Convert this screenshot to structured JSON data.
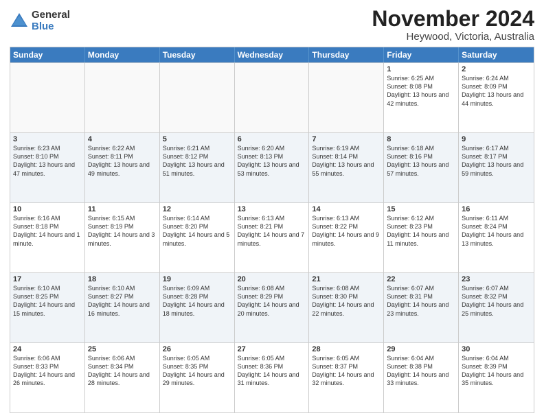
{
  "logo": {
    "general": "General",
    "blue": "Blue"
  },
  "title": "November 2024",
  "subtitle": "Heywood, Victoria, Australia",
  "days_of_week": [
    "Sunday",
    "Monday",
    "Tuesday",
    "Wednesday",
    "Thursday",
    "Friday",
    "Saturday"
  ],
  "weeks": [
    [
      {
        "day": "",
        "info": ""
      },
      {
        "day": "",
        "info": ""
      },
      {
        "day": "",
        "info": ""
      },
      {
        "day": "",
        "info": ""
      },
      {
        "day": "",
        "info": ""
      },
      {
        "day": "1",
        "info": "Sunrise: 6:25 AM\nSunset: 8:08 PM\nDaylight: 13 hours and 42 minutes."
      },
      {
        "day": "2",
        "info": "Sunrise: 6:24 AM\nSunset: 8:09 PM\nDaylight: 13 hours and 44 minutes."
      }
    ],
    [
      {
        "day": "3",
        "info": "Sunrise: 6:23 AM\nSunset: 8:10 PM\nDaylight: 13 hours and 47 minutes."
      },
      {
        "day": "4",
        "info": "Sunrise: 6:22 AM\nSunset: 8:11 PM\nDaylight: 13 hours and 49 minutes."
      },
      {
        "day": "5",
        "info": "Sunrise: 6:21 AM\nSunset: 8:12 PM\nDaylight: 13 hours and 51 minutes."
      },
      {
        "day": "6",
        "info": "Sunrise: 6:20 AM\nSunset: 8:13 PM\nDaylight: 13 hours and 53 minutes."
      },
      {
        "day": "7",
        "info": "Sunrise: 6:19 AM\nSunset: 8:14 PM\nDaylight: 13 hours and 55 minutes."
      },
      {
        "day": "8",
        "info": "Sunrise: 6:18 AM\nSunset: 8:16 PM\nDaylight: 13 hours and 57 minutes."
      },
      {
        "day": "9",
        "info": "Sunrise: 6:17 AM\nSunset: 8:17 PM\nDaylight: 13 hours and 59 minutes."
      }
    ],
    [
      {
        "day": "10",
        "info": "Sunrise: 6:16 AM\nSunset: 8:18 PM\nDaylight: 14 hours and 1 minute."
      },
      {
        "day": "11",
        "info": "Sunrise: 6:15 AM\nSunset: 8:19 PM\nDaylight: 14 hours and 3 minutes."
      },
      {
        "day": "12",
        "info": "Sunrise: 6:14 AM\nSunset: 8:20 PM\nDaylight: 14 hours and 5 minutes."
      },
      {
        "day": "13",
        "info": "Sunrise: 6:13 AM\nSunset: 8:21 PM\nDaylight: 14 hours and 7 minutes."
      },
      {
        "day": "14",
        "info": "Sunrise: 6:13 AM\nSunset: 8:22 PM\nDaylight: 14 hours and 9 minutes."
      },
      {
        "day": "15",
        "info": "Sunrise: 6:12 AM\nSunset: 8:23 PM\nDaylight: 14 hours and 11 minutes."
      },
      {
        "day": "16",
        "info": "Sunrise: 6:11 AM\nSunset: 8:24 PM\nDaylight: 14 hours and 13 minutes."
      }
    ],
    [
      {
        "day": "17",
        "info": "Sunrise: 6:10 AM\nSunset: 8:25 PM\nDaylight: 14 hours and 15 minutes."
      },
      {
        "day": "18",
        "info": "Sunrise: 6:10 AM\nSunset: 8:27 PM\nDaylight: 14 hours and 16 minutes."
      },
      {
        "day": "19",
        "info": "Sunrise: 6:09 AM\nSunset: 8:28 PM\nDaylight: 14 hours and 18 minutes."
      },
      {
        "day": "20",
        "info": "Sunrise: 6:08 AM\nSunset: 8:29 PM\nDaylight: 14 hours and 20 minutes."
      },
      {
        "day": "21",
        "info": "Sunrise: 6:08 AM\nSunset: 8:30 PM\nDaylight: 14 hours and 22 minutes."
      },
      {
        "day": "22",
        "info": "Sunrise: 6:07 AM\nSunset: 8:31 PM\nDaylight: 14 hours and 23 minutes."
      },
      {
        "day": "23",
        "info": "Sunrise: 6:07 AM\nSunset: 8:32 PM\nDaylight: 14 hours and 25 minutes."
      }
    ],
    [
      {
        "day": "24",
        "info": "Sunrise: 6:06 AM\nSunset: 8:33 PM\nDaylight: 14 hours and 26 minutes."
      },
      {
        "day": "25",
        "info": "Sunrise: 6:06 AM\nSunset: 8:34 PM\nDaylight: 14 hours and 28 minutes."
      },
      {
        "day": "26",
        "info": "Sunrise: 6:05 AM\nSunset: 8:35 PM\nDaylight: 14 hours and 29 minutes."
      },
      {
        "day": "27",
        "info": "Sunrise: 6:05 AM\nSunset: 8:36 PM\nDaylight: 14 hours and 31 minutes."
      },
      {
        "day": "28",
        "info": "Sunrise: 6:05 AM\nSunset: 8:37 PM\nDaylight: 14 hours and 32 minutes."
      },
      {
        "day": "29",
        "info": "Sunrise: 6:04 AM\nSunset: 8:38 PM\nDaylight: 14 hours and 33 minutes."
      },
      {
        "day": "30",
        "info": "Sunrise: 6:04 AM\nSunset: 8:39 PM\nDaylight: 14 hours and 35 minutes."
      }
    ]
  ]
}
